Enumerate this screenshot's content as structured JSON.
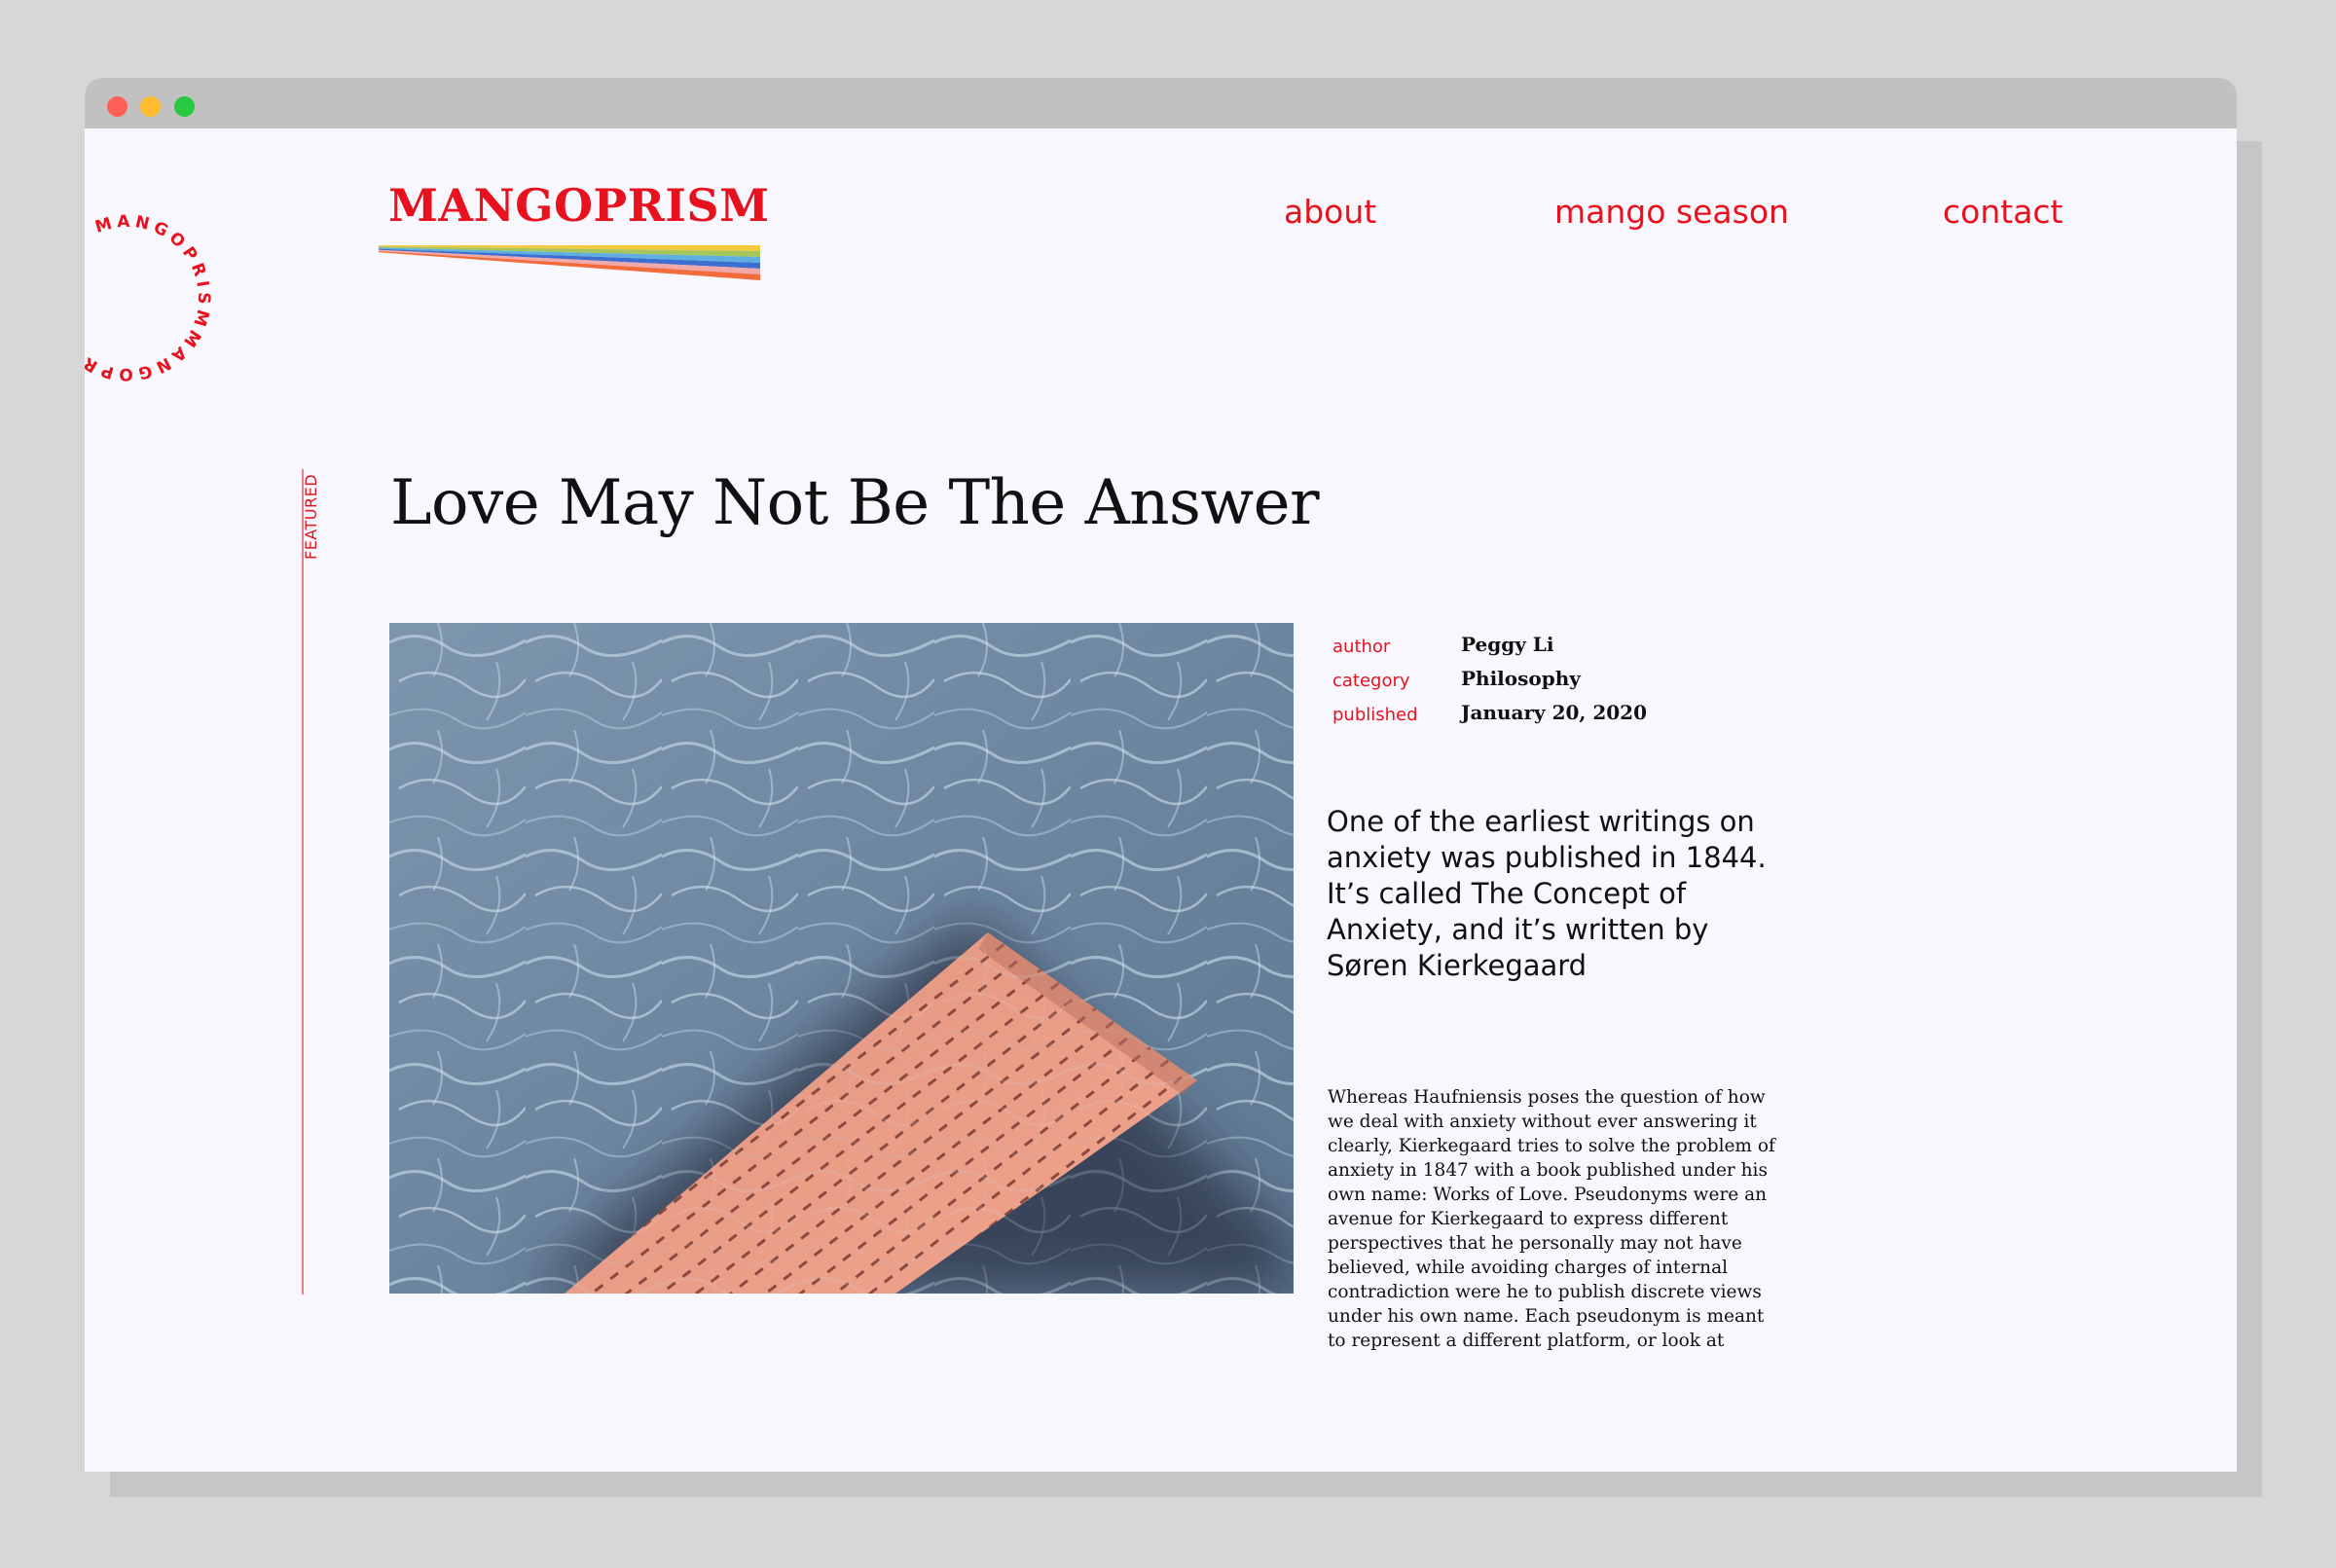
{
  "brand": {
    "logo_text": "MANGOPRISM",
    "seal_text": "MANGOPRISMMANGOPRISM",
    "accent_color": "#e8121e",
    "rainbow_colors": [
      "#f3c940",
      "#a6c659",
      "#5fb0e0",
      "#3d6fd1",
      "#f0a8a8",
      "#f36b3b"
    ]
  },
  "window": {
    "controls": [
      "close",
      "minimize",
      "zoom"
    ]
  },
  "nav": {
    "items": [
      {
        "label": "about"
      },
      {
        "label": "mango season"
      },
      {
        "label": "contact"
      }
    ]
  },
  "article": {
    "badge": "FEATURED",
    "title": "Love May Not Be The Answer",
    "meta": [
      {
        "key": "author",
        "value": "Peggy Li"
      },
      {
        "key": "category",
        "value": "Philosophy"
      },
      {
        "key": "published",
        "value": "January 20, 2020"
      }
    ],
    "lead": "One of the earliest writings on anxiety was published in 1844. It’s called The Concept of Anxiety, and it’s written by Søren Kierkegaard",
    "body": "Whereas Haufniensis poses the question of how we deal with anxiety without ever answering it clearly, Kierkegaard tries to solve the problem of anxiety in 1847 with a book published under his own name: Works of Love. Pseudonyms were an avenue for Kierkegaard to express different perspectives that he personally may not have believed, while avoiding charges of internal contradiction were he to publish discrete views under his own name. Each pseudonym is meant to represent a different platform, or look at"
  }
}
